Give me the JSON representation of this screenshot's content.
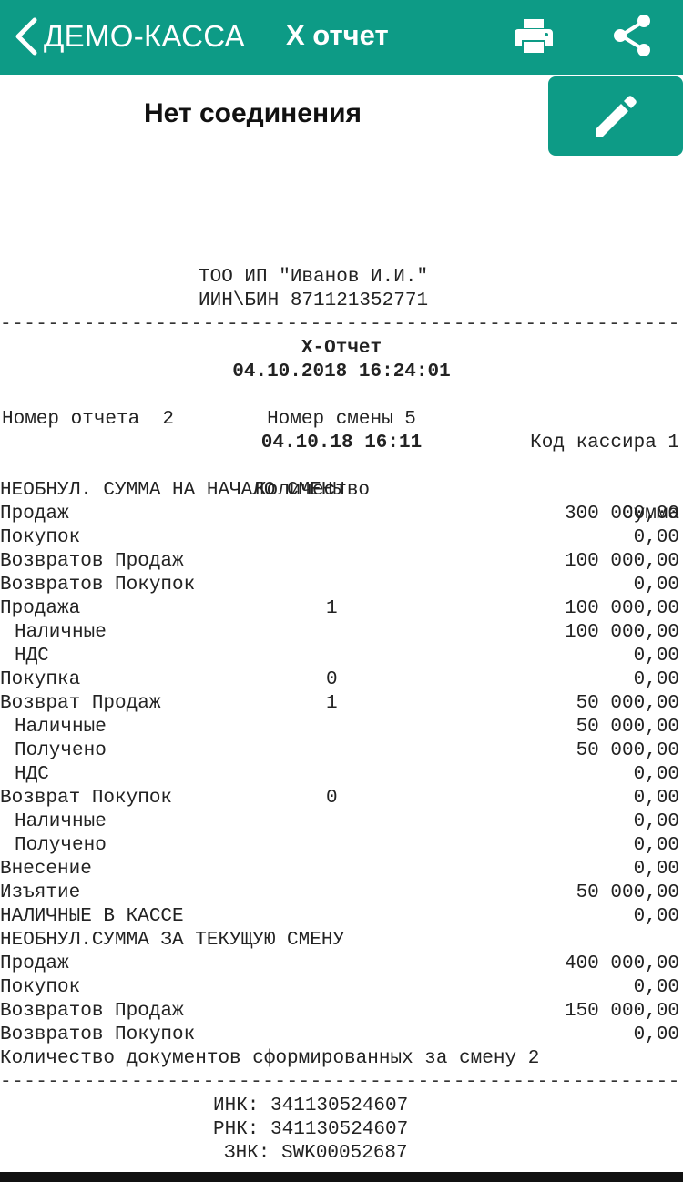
{
  "nav": {
    "back_label": "ДЕМО-КАССА",
    "title": "X отчет"
  },
  "status": "Нет соединения",
  "receipt": {
    "org_name": "ТОО ИП \"Иванов И.И.\"",
    "inn_line": "ИИН\\БИН 871121352771",
    "separator": "------------------------------------------------------------",
    "report_title": "X-Отчет",
    "report_datetime": "04.10.2018 16:24:01",
    "report_number_label": "Номер отчета  2",
    "cashier_code_label": "Код кассира 1",
    "shift_number": "Номер смены 5",
    "shift_datetime": "04.10.18 16:11",
    "col_qty": "Количество",
    "col_sum": "Сумма",
    "section1_title": "НЕОБНУЛ. СУММА НА НАЧАЛО СМЕНЫ",
    "rows": [
      {
        "label": "Продаж",
        "qty": "",
        "amount": "300 000,00",
        "indent": false
      },
      {
        "label": "Покупок",
        "qty": "",
        "amount": "0,00",
        "indent": false
      },
      {
        "label": "Возвратов Продаж",
        "qty": "",
        "amount": "100 000,00",
        "indent": false
      },
      {
        "label": "Возвратов Покупок",
        "qty": "",
        "amount": "0,00",
        "indent": false
      },
      {
        "label": "Продажа",
        "qty": "1",
        "amount": "100 000,00",
        "indent": false
      },
      {
        "label": "Наличные",
        "qty": "",
        "amount": "100 000,00",
        "indent": true
      },
      {
        "label": "НДС",
        "qty": "",
        "amount": "0,00",
        "indent": true
      },
      {
        "label": "Покупка",
        "qty": "0",
        "amount": "0,00",
        "indent": false
      },
      {
        "label": "Возврат Продаж",
        "qty": "1",
        "amount": "50 000,00",
        "indent": false
      },
      {
        "label": "Наличные",
        "qty": "",
        "amount": "50 000,00",
        "indent": true
      },
      {
        "label": "Получено",
        "qty": "",
        "amount": "50 000,00",
        "indent": true
      },
      {
        "label": "НДС",
        "qty": "",
        "amount": "0,00",
        "indent": true
      },
      {
        "label": "Возврат Покупок",
        "qty": "0",
        "amount": "0,00",
        "indent": false
      },
      {
        "label": "Наличные",
        "qty": "",
        "amount": "0,00",
        "indent": true
      },
      {
        "label": "Получено",
        "qty": "",
        "amount": "0,00",
        "indent": true
      },
      {
        "label": "Внесение",
        "qty": "",
        "amount": "0,00",
        "indent": false
      },
      {
        "label": "Изъятие",
        "qty": "",
        "amount": "50 000,00",
        "indent": false
      },
      {
        "label": "НАЛИЧНЫЕ В КАССЕ",
        "qty": "",
        "amount": "0,00",
        "indent": false
      }
    ],
    "section2_title": "НЕОБНУЛ.СУММА ЗА ТЕКУЩУЮ СМЕНУ",
    "rows2": [
      {
        "label": "Продаж",
        "amount": "400 000,00"
      },
      {
        "label": "Покупок",
        "amount": "0,00"
      },
      {
        "label": "Возвратов Продаж",
        "amount": "150 000,00"
      },
      {
        "label": "Возвратов Покупок",
        "amount": "0,00"
      }
    ],
    "docs_count_line": "Количество документов сформированных за смену 2",
    "inc_line": "ИНК: 341130524607",
    "rnk_line": "РНК: 341130524607",
    "znk_line": "ЗНК: SWK00052687"
  },
  "icons": {
    "back": "chevron-left-icon",
    "print": "printer-icon",
    "share": "share-icon",
    "edit": "pencil-icon"
  },
  "colors": {
    "accent": "#0d9b86"
  }
}
